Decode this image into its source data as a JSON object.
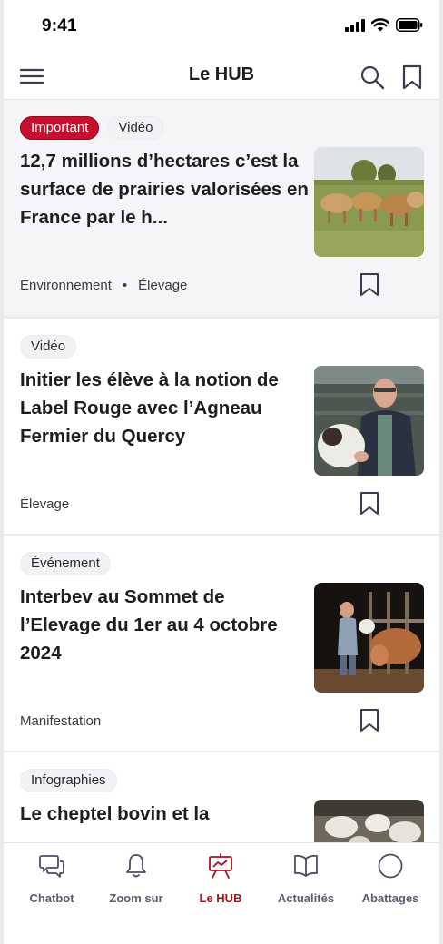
{
  "status_bar": {
    "time": "9:41"
  },
  "header": {
    "title": "Le HUB",
    "menu_icon": "hamburger-menu-icon",
    "search_icon": "search-icon",
    "bookmark_icon": "bookmark-icon"
  },
  "colors": {
    "brand_red": "#c8102e",
    "active_tab": "#a8141f",
    "text": "#1d1d22"
  },
  "feed": {
    "cards": [
      {
        "tags": [
          "Important",
          "Vidéo"
        ],
        "title": "12,7 millions d’hectares c’est la surface de prairies valorisées en France par le h...",
        "categories": [
          "Environnement",
          "Élevage"
        ],
        "separator": "•",
        "image": "cows-in-pasture"
      },
      {
        "tags": [
          "Vidéo"
        ],
        "title": "Initier les élève à la notion de Label Rouge avec l’Agneau Fermier du Quercy",
        "categories": [
          "Élevage"
        ],
        "image": "farmer-with-lamb"
      },
      {
        "tags": [
          "Événement"
        ],
        "title": "Interbev au Sommet de l’Elevage du 1er au 4 octobre 2024",
        "categories": [
          "Manifestation"
        ],
        "image": "farmer-feeding-calves"
      },
      {
        "tags": [
          "Infographies"
        ],
        "title": "Le cheptel bovin et la",
        "categories": [],
        "image": "sheep-in-barn"
      }
    ]
  },
  "tabbar": {
    "items": [
      {
        "label": "Chatbot",
        "icon": "chat-bubbles-icon",
        "active": false
      },
      {
        "label": "Zoom sur",
        "icon": "bell-icon",
        "active": false
      },
      {
        "label": "Le HUB",
        "icon": "presentation-board-icon",
        "active": true
      },
      {
        "label": "Actualités",
        "icon": "open-book-icon",
        "active": false
      },
      {
        "label": "Abattages",
        "icon": "circle-icon",
        "active": false
      }
    ]
  }
}
